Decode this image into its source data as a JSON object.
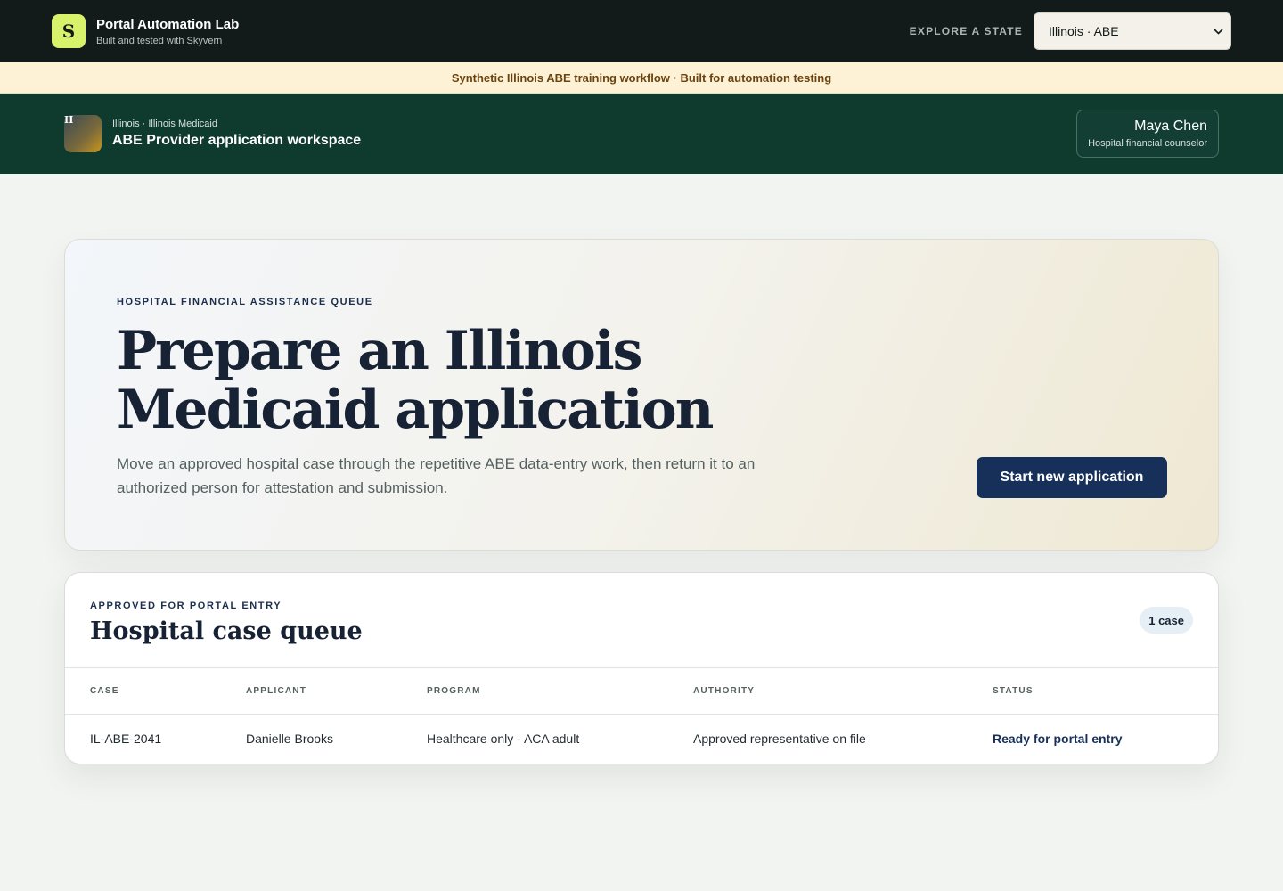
{
  "topbar": {
    "logo_letter": "S",
    "title": "Portal Automation Lab",
    "subtitle": "Built and tested with Skyvern",
    "state_label": "EXPLORE A STATE",
    "state_selected": "Illinois · ABE"
  },
  "notice": {
    "text": "Synthetic Illinois ABE training workflow · Built for automation testing"
  },
  "workspace": {
    "avatar_letter": "H",
    "breadcrumb": "Illinois · Illinois Medicaid",
    "title": "ABE Provider application workspace",
    "user_name": "Maya Chen",
    "user_role": "Hospital financial counselor"
  },
  "hero": {
    "kicker": "HOSPITAL FINANCIAL ASSISTANCE QUEUE",
    "title": "Prepare an Illinois Medicaid application",
    "description": "Move an approved hospital case through the repetitive ABE data-entry work, then return it to an authorized person for attestation and submission.",
    "button_label": "Start new application"
  },
  "queue": {
    "kicker": "APPROVED FOR PORTAL ENTRY",
    "title": "Hospital case queue",
    "count_badge": "1 case",
    "columns": [
      "CASE",
      "APPLICANT",
      "PROGRAM",
      "AUTHORITY",
      "STATUS"
    ],
    "rows": [
      {
        "case": "IL-ABE-2041",
        "applicant": "Danielle Brooks",
        "program": "Healthcare only · ACA adult",
        "authority": "Approved representative on file",
        "status": "Ready for portal entry"
      }
    ]
  },
  "colors": {
    "topbar_bg": "#121a1a",
    "brand_accent": "#d9f26b",
    "notice_bg": "#fdf2d6",
    "workspace_bg": "#0f3b2f",
    "primary_button": "#16305a"
  },
  "icons": {
    "select_caret": "chevron-down-icon"
  }
}
